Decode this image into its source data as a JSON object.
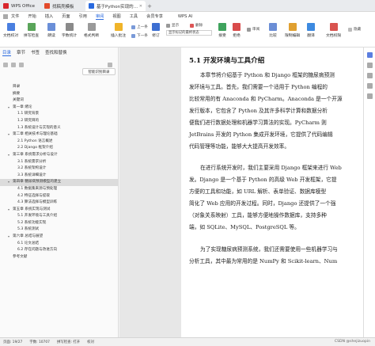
{
  "tabs": [
    {
      "label": "WPS Office",
      "color": "#d8262c"
    },
    {
      "label": "找稿壳模板",
      "color": "#e24a2b"
    },
    {
      "label": "基于Python实现的糖尿病预测",
      "color": "#2a6adf"
    }
  ],
  "menu": {
    "file": "文件",
    "items": [
      "开始",
      "插入",
      "页面",
      "引用",
      "审阅",
      "视图",
      "工具",
      "会员专享"
    ],
    "active": "审阅",
    "ai": "WPS AI"
  },
  "toolbar": {
    "buttons": [
      "文档校对",
      "拼写检查",
      "朗读",
      "字数统计",
      "格式判断",
      "插入批注",
      "上一条",
      "下一条",
      "修订",
      "接受",
      "拒绝",
      "比较",
      "限制编辑",
      "文档权限"
    ],
    "small": [
      "翻译",
      "显示",
      "删除",
      "审阅",
      "隐藏"
    ],
    "select_value": "显示标记的最终状态"
  },
  "nav": {
    "tabs": [
      "目录",
      "章节",
      "书签",
      "查找和替换"
    ],
    "active_tab": "目录",
    "smart_button": "智能识别目录",
    "toc": [
      {
        "text": "目录",
        "level": 1
      },
      {
        "text": "摘要",
        "level": 1
      },
      {
        "text": "关键词",
        "level": 1
      },
      {
        "text": "第一章 绪论",
        "level": 1,
        "expandable": true
      },
      {
        "text": "1.1 研究背景",
        "level": 2
      },
      {
        "text": "1.2 研究目的",
        "level": 2
      },
      {
        "text": "1.3 系统设计与实现的意义",
        "level": 2
      },
      {
        "text": "第二章 相关技术与理论基础",
        "level": 1,
        "expandable": true
      },
      {
        "text": "2.1 Python 语言概述",
        "level": 2
      },
      {
        "text": "2.2 Django 框架介绍",
        "level": 2
      },
      {
        "text": "第三章 系统需求分析与设计",
        "level": 1,
        "expandable": true
      },
      {
        "text": "3.1 系统需求分析",
        "level": 2
      },
      {
        "text": "3.2 系统架构设计",
        "level": 2
      },
      {
        "text": "3.3 系统详细设计",
        "level": 2
      },
      {
        "text": "第四章 糖尿病预测模型的建立",
        "level": 1,
        "expandable": true,
        "selected": true
      },
      {
        "text": "4.1 数据集来源与预处理",
        "level": 2
      },
      {
        "text": "4.2 特征选择与提取",
        "level": 2
      },
      {
        "text": "4.3 算法选择与模型训练",
        "level": 2
      },
      {
        "text": "第五章 系统实现与测试",
        "level": 1,
        "expandable": true
      },
      {
        "text": "5.1 开发环境与工具介绍",
        "level": 2
      },
      {
        "text": "5.2 系统功能实现",
        "level": 2
      },
      {
        "text": "5.3 系统测试",
        "level": 2
      },
      {
        "text": "第六章 总结与展望",
        "level": 1,
        "expandable": true
      },
      {
        "text": "6.1 论文总结",
        "level": 2
      },
      {
        "text": "6.2 存在问题与改进方向",
        "level": 2
      },
      {
        "text": "参考文献",
        "level": 1
      }
    ]
  },
  "document": {
    "heading": "5.1 开发环境与工具介绍",
    "paragraphs": [
      [
        "本章节将介绍基于 Python 和 Django 框架的糖尿病预测",
        "发环境与工具。首先，我们需要一个适用于 Python 编程的",
        "比较常用的有 Anaconda 和 PyCharm。Anaconda 是一个开源",
        "发行版本，它包含了 Python 及其许多科学计算和数据分析",
        "便我们进行数据处理和机器学习算法的实现。PyCharm 则",
        "JetBrains 开发的 Python 集成开发环境，它提供了代码编辑",
        "代码管理等功能，能够大大提高开发效率。"
      ],
      [
        "在进行系统开发时，我们主要采用 Django 框架来进行 Web",
        "发。Django 是一个基于 Python 的高级 Web 开发框架，它提",
        "方便的工具和功能，如 URL 解析、表单验证、数据库模型",
        "简化了 Web 应用的开发过程。同时，Django 还提供了一个强",
        "（对象关系映射）工具，能够方便地操作数据库，支持多种",
        "端，如 SQLite、MySQL、PostgreSQL 等。"
      ],
      [
        "为了实现糖尿病预测系统，我们还需要使用一些机器学习与",
        "分析工具，其中最为常用的是 NumPy 和 Scikit-learn、Num"
      ]
    ]
  },
  "status": {
    "page": "页面: 19/27",
    "words": "字数: 10707",
    "spell": "拼写检查: 打开",
    "proof": "校对"
  },
  "watermark": "CSDN @shejizuopin"
}
